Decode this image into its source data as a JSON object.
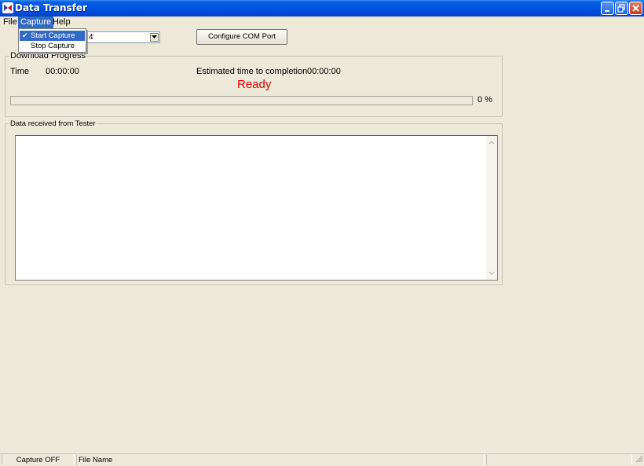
{
  "window": {
    "title": "Data Transfer"
  },
  "menubar": {
    "items": [
      "File",
      "Capture",
      "Help"
    ]
  },
  "capture_menu": {
    "items": [
      "Start Capture",
      "Stop Capture"
    ],
    "checked": "Start Capture"
  },
  "com_port": {
    "value": "4"
  },
  "toolbar": {
    "configure_label": "Configure COM Port"
  },
  "download": {
    "group_label": "Download Progress",
    "time_label": "Time",
    "time_value": "00:00:00",
    "eta_label": "Estimated time to completion",
    "eta_value": "00:00:00",
    "status": "Ready",
    "progress_percent": 0,
    "progress_text": "0 %"
  },
  "received": {
    "group_label": "Data received from Tester",
    "content": ""
  },
  "statusbar": {
    "capture": "Capture OFF",
    "file": "File Name"
  },
  "colors": {
    "ready": "#e00000",
    "highlight": "#316ac5",
    "titlebar": "#0055e5"
  }
}
